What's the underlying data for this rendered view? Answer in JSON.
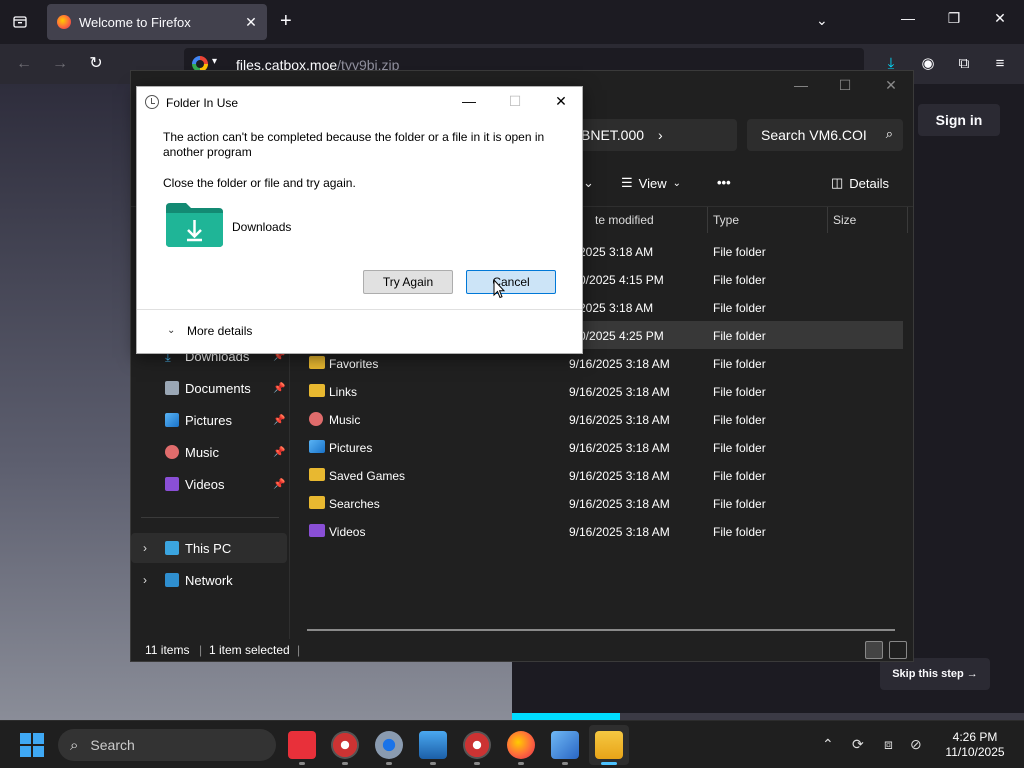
{
  "firefox": {
    "tab_title": "Welcome to Firefox",
    "url_domain": "files.catbox.moe",
    "url_path": "/tyy9bi.zip",
    "sign_in": "Sign in",
    "skip_step": "Skip this step →",
    "onboarding_progress": 0.21
  },
  "explorer": {
    "address_segment": "BNET.000",
    "search_placeholder": "Search VM6.COI",
    "toolbar": {
      "view_label": "View",
      "details_label": "Details",
      "more_label": "•••"
    },
    "columns": [
      "te modified",
      "Type",
      "Size"
    ],
    "nav": [
      {
        "label": "Downloads",
        "pinned": true
      },
      {
        "label": "Documents",
        "pinned": true
      },
      {
        "label": "Pictures",
        "pinned": true
      },
      {
        "label": "Music",
        "pinned": true
      },
      {
        "label": "Videos",
        "pinned": true
      }
    ],
    "nav_roots": [
      {
        "label": "This PC"
      },
      {
        "label": "Network"
      }
    ],
    "files": [
      {
        "name": "",
        "date": "6/2025 3:18 AM",
        "type": "File folder"
      },
      {
        "name": "",
        "date": "/10/2025 4:15 PM",
        "type": "File folder"
      },
      {
        "name": "",
        "date": "6/2025 3:18 AM",
        "type": "File folder"
      },
      {
        "name": "",
        "date": "/10/2025 4:25 PM",
        "type": "File folder"
      },
      {
        "name": "Favorites",
        "date": "9/16/2025 3:18 AM",
        "type": "File folder"
      },
      {
        "name": "Links",
        "date": "9/16/2025 3:18 AM",
        "type": "File folder"
      },
      {
        "name": "Music",
        "date": "9/16/2025 3:18 AM",
        "type": "File folder"
      },
      {
        "name": "Pictures",
        "date": "9/16/2025 3:18 AM",
        "type": "File folder"
      },
      {
        "name": "Saved Games",
        "date": "9/16/2025 3:18 AM",
        "type": "File folder"
      },
      {
        "name": "Searches",
        "date": "9/16/2025 3:18 AM",
        "type": "File folder"
      },
      {
        "name": "Videos",
        "date": "9/16/2025 3:18 AM",
        "type": "File folder"
      }
    ],
    "status_items": "11 items",
    "status_selected": "1 item selected"
  },
  "dialog": {
    "title": "Folder In Use",
    "message": "The action can't be completed because the folder or a file in it is open in another program",
    "instruction": "Close the folder or file and try again.",
    "folder_name": "Downloads",
    "try_again": "Try Again",
    "cancel": "Cancel",
    "more_details": "More details"
  },
  "taskbar": {
    "search_label": "Search",
    "time": "4:26 PM",
    "date": "11/10/2025"
  },
  "colors": {
    "accent": "#0078d7",
    "folder": "#e8b830",
    "downloads_folder": "#1aa58a",
    "progress": "#00ddff"
  }
}
